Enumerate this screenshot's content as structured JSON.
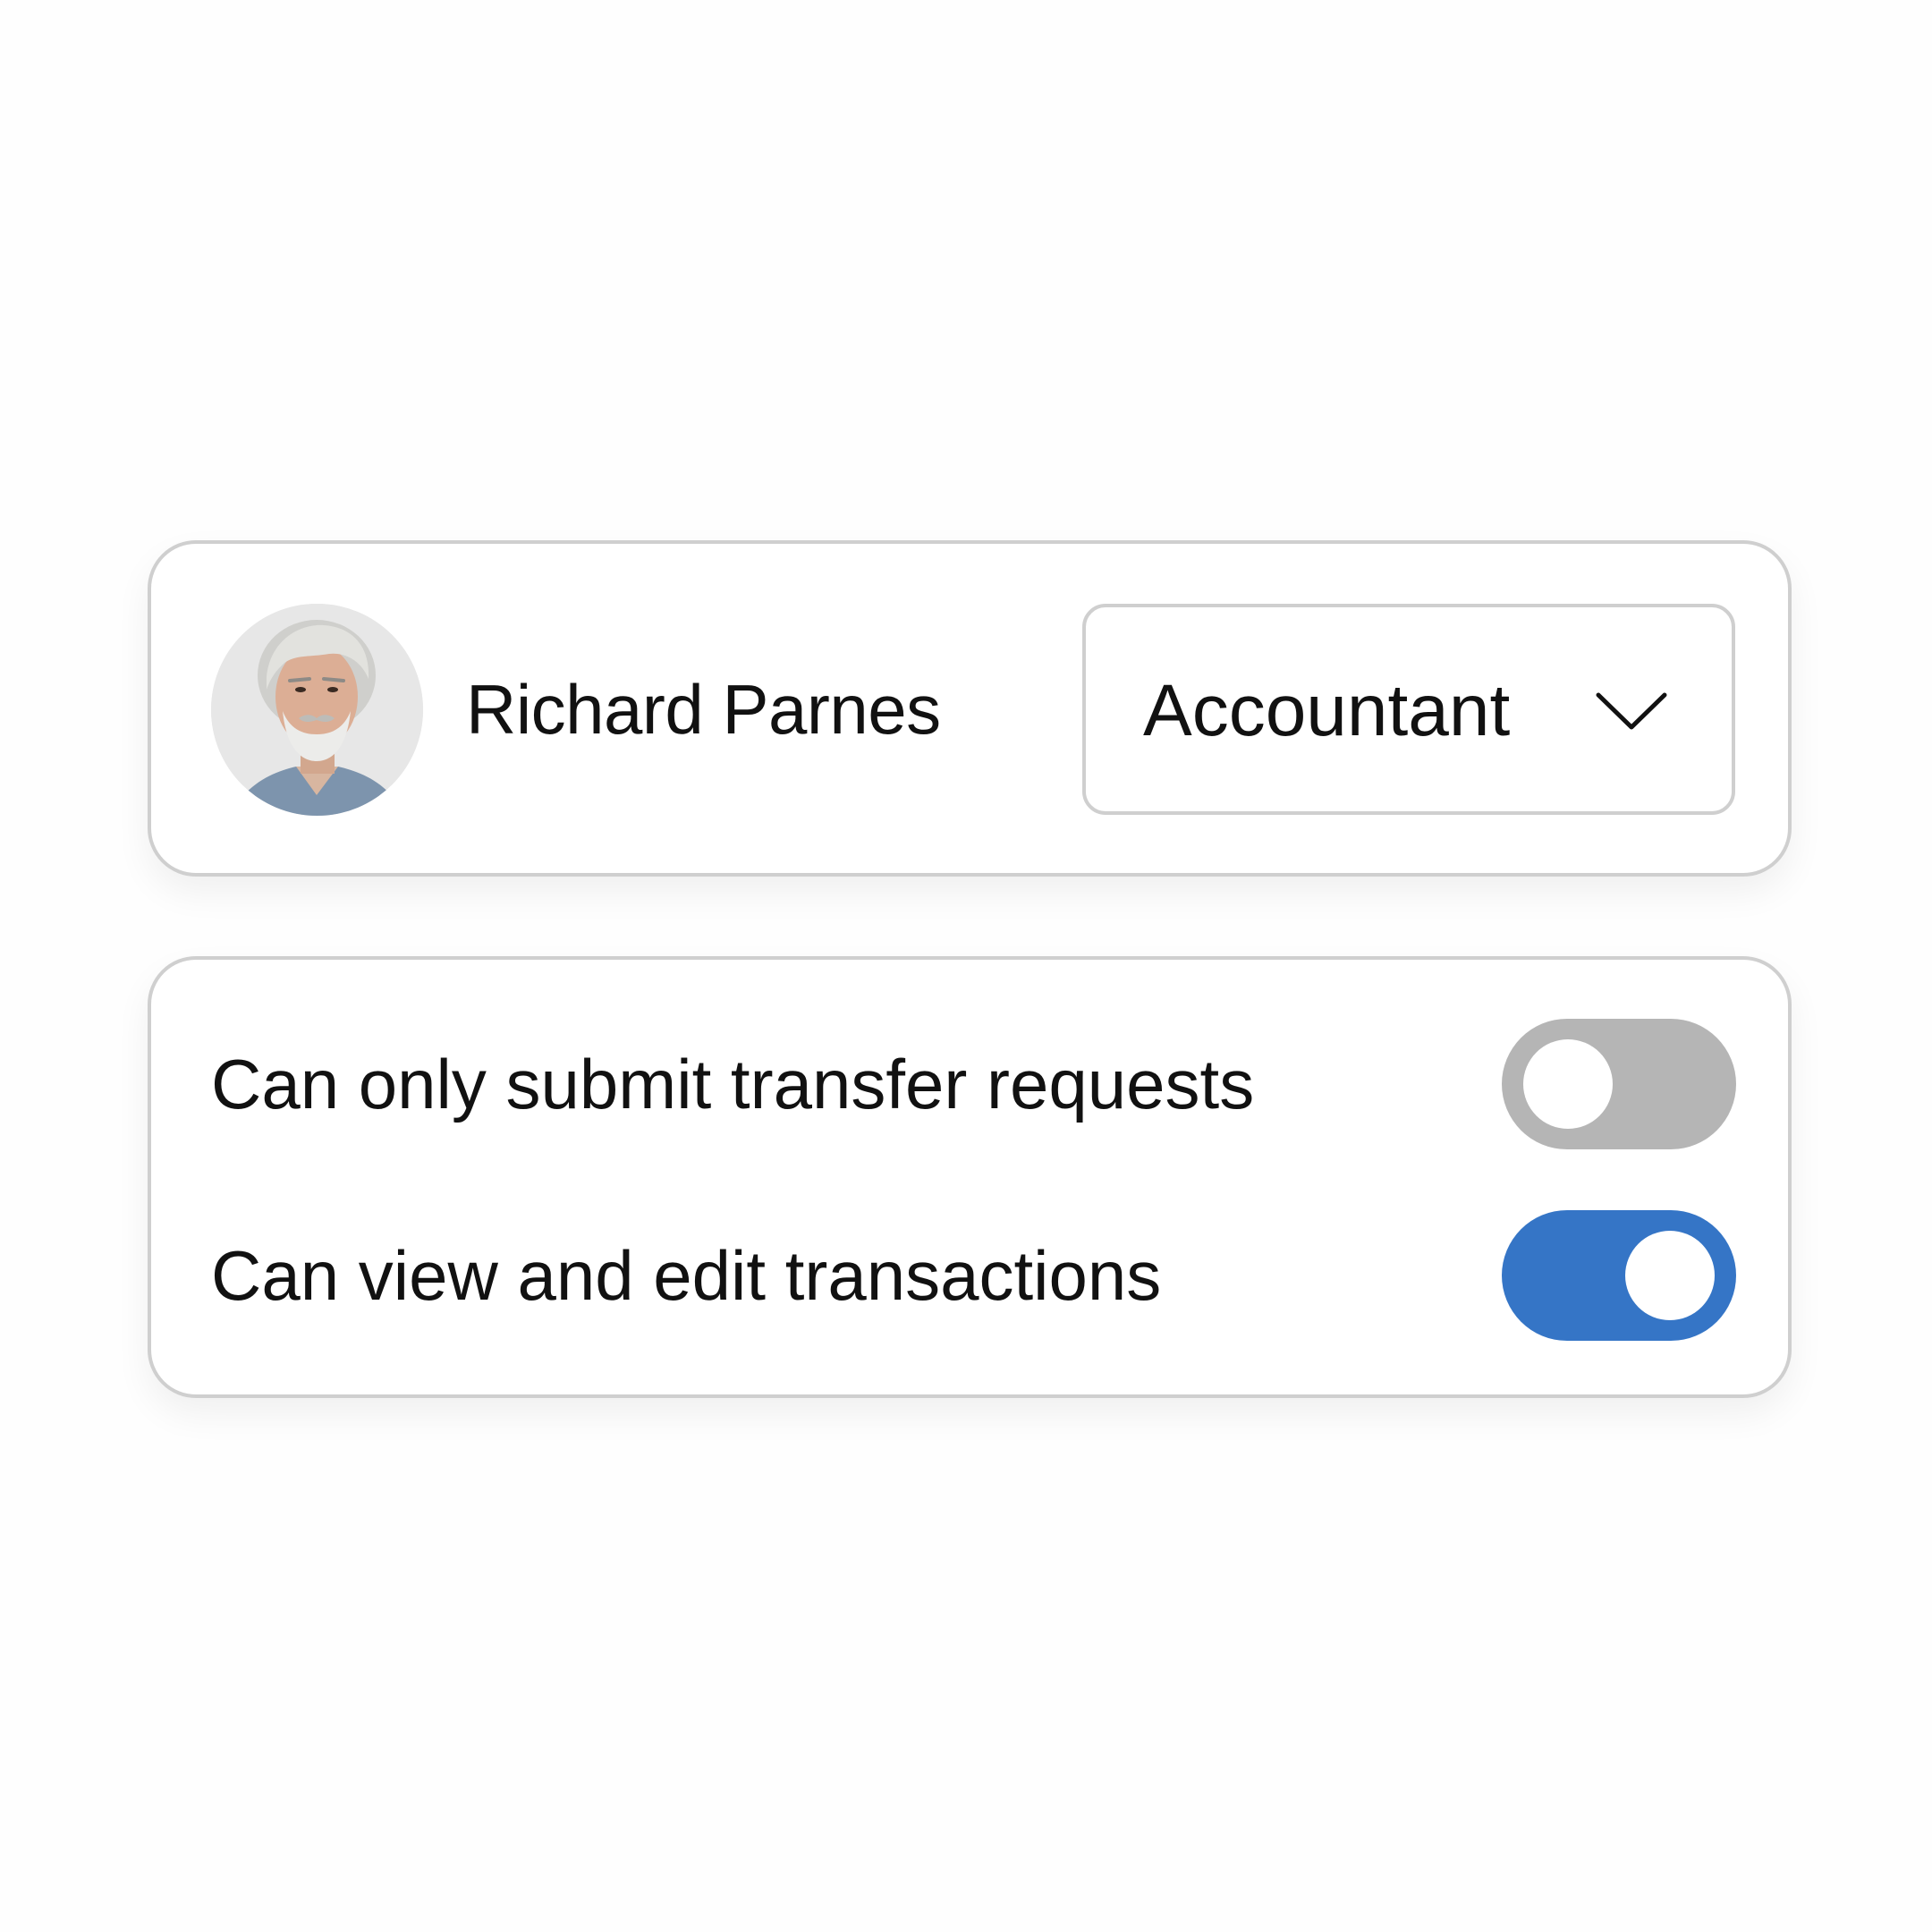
{
  "user": {
    "name": "Richard Parnes",
    "role": "Accountant"
  },
  "permissions": [
    {
      "label": "Can only submit transfer requests",
      "enabled": false
    },
    {
      "label": "Can view and edit transactions",
      "enabled": true
    }
  ],
  "colors": {
    "toggle_on": "#3575c6",
    "toggle_off": "#b5b5b5",
    "border": "#cfcfcf"
  },
  "icons": {
    "role_dropdown": "chevron-down-icon",
    "avatar": "user-photo"
  }
}
